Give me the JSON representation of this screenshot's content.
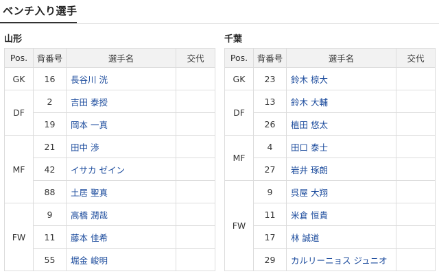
{
  "header": {
    "title": "ベンチ入り選手"
  },
  "columns": {
    "pos": "Pos.",
    "number": "背番号",
    "player": "選手名",
    "sub": "交代"
  },
  "teams": [
    {
      "name": "山形",
      "groups": [
        {
          "pos": "GK",
          "players": [
            {
              "number": "16",
              "name": "長谷川 洸"
            }
          ]
        },
        {
          "pos": "DF",
          "players": [
            {
              "number": "2",
              "name": "吉田 泰授"
            },
            {
              "number": "19",
              "name": "岡本 一真"
            }
          ]
        },
        {
          "pos": "MF",
          "players": [
            {
              "number": "21",
              "name": "田中 渉"
            },
            {
              "number": "42",
              "name": "イサカ ゼイン"
            },
            {
              "number": "88",
              "name": "土居 聖真"
            }
          ]
        },
        {
          "pos": "FW",
          "players": [
            {
              "number": "9",
              "name": "高橋 潤哉"
            },
            {
              "number": "11",
              "name": "藤本 佳希"
            },
            {
              "number": "55",
              "name": "堀金 峻明"
            }
          ]
        }
      ]
    },
    {
      "name": "千葉",
      "groups": [
        {
          "pos": "GK",
          "players": [
            {
              "number": "23",
              "name": "鈴木 椋大"
            }
          ]
        },
        {
          "pos": "DF",
          "players": [
            {
              "number": "13",
              "name": "鈴木 大輔"
            },
            {
              "number": "26",
              "name": "植田 悠太"
            }
          ]
        },
        {
          "pos": "MF",
          "players": [
            {
              "number": "4",
              "name": "田口 泰士"
            },
            {
              "number": "27",
              "name": "岩井 琢朗"
            }
          ]
        },
        {
          "pos": "FW",
          "players": [
            {
              "number": "9",
              "name": "呉屋 大翔"
            },
            {
              "number": "11",
              "name": "米倉 恒貴"
            },
            {
              "number": "17",
              "name": "林 誠道"
            },
            {
              "number": "29",
              "name": "カルリーニョス ジュニオ"
            }
          ]
        }
      ]
    }
  ],
  "colors": {
    "link": "#1a4a9c",
    "header_bg": "#f2f2f2",
    "border": "#dcdcdc"
  }
}
